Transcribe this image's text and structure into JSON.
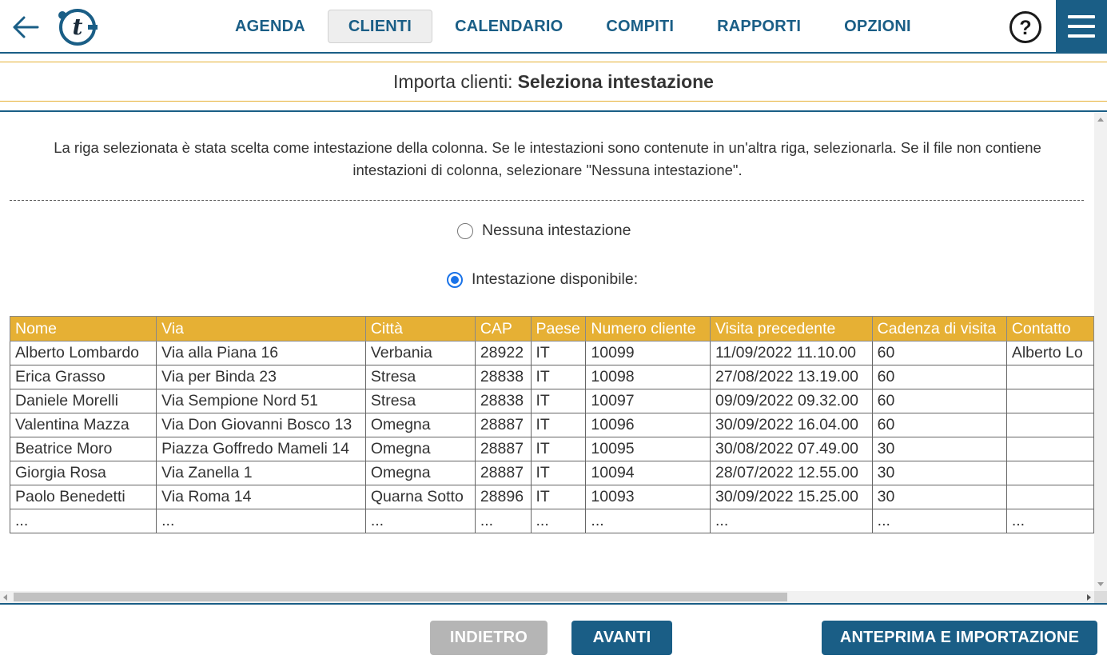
{
  "nav": {
    "items": [
      {
        "label": "AGENDA",
        "active": false
      },
      {
        "label": "CLIENTI",
        "active": true
      },
      {
        "label": "CALENDARIO",
        "active": false
      },
      {
        "label": "COMPITI",
        "active": false
      },
      {
        "label": "RAPPORTI",
        "active": false
      },
      {
        "label": "OPZIONI",
        "active": false
      }
    ],
    "help_label": "?",
    "logo_letter": "t"
  },
  "page": {
    "title_prefix": "Importa clienti:",
    "title_main": "Seleziona intestazione",
    "intro": "La riga selezionata è stata scelta come intestazione della colonna. Se le intestazioni sono contenute in un'altra riga, selezionarla. Se il file non contiene intestazioni di colonna, selezionare \"Nessuna intestazione\"."
  },
  "options": {
    "no_header": {
      "label": "Nessuna intestazione",
      "checked": false
    },
    "header_available": {
      "label": "Intestazione disponibile:",
      "checked": true
    }
  },
  "table": {
    "columns": [
      "Nome",
      "Via",
      "Città",
      "CAP",
      "Paese",
      "Numero cliente",
      "Visita precedente",
      "Cadenza di visita",
      "Contatto"
    ],
    "rows": [
      [
        "Alberto Lombardo",
        "Via alla Piana 16",
        "Verbania",
        "28922",
        "IT",
        "10099",
        "11/09/2022 11.10.00",
        "60",
        "Alberto Lo"
      ],
      [
        "Erica Grasso",
        "Via per Binda 23",
        "Stresa",
        "28838",
        "IT",
        "10098",
        "27/08/2022 13.19.00",
        "60",
        ""
      ],
      [
        "Daniele Morelli",
        "Via Sempione Nord 51",
        "Stresa",
        "28838",
        "IT",
        "10097",
        "09/09/2022 09.32.00",
        "60",
        ""
      ],
      [
        "Valentina Mazza",
        "Via Don Giovanni Bosco 13",
        "Omegna",
        "28887",
        "IT",
        "10096",
        "30/09/2022 16.04.00",
        "60",
        ""
      ],
      [
        "Beatrice Moro",
        "Piazza Goffredo Mameli 14",
        "Omegna",
        "28887",
        "IT",
        "10095",
        "30/08/2022 07.49.00",
        "30",
        ""
      ],
      [
        "Giorgia Rosa",
        "Via Zanella 1",
        "Omegna",
        "28887",
        "IT",
        "10094",
        "28/07/2022 12.55.00",
        "30",
        ""
      ],
      [
        "Paolo Benedetti",
        "Via Roma 14",
        "Quarna Sotto",
        "28896",
        "IT",
        "10093",
        "30/09/2022 15.25.00",
        "30",
        ""
      ],
      [
        "...",
        "...",
        "...",
        "...",
        "...",
        "...",
        "...",
        "...",
        "..."
      ]
    ]
  },
  "footer": {
    "back_label": "INDIETRO",
    "next_label": "AVANTI",
    "import_label": "ANTEPRIMA E IMPORTAZIONE"
  },
  "colors": {
    "primary": "#1a5e86",
    "header_accent": "#e6b034",
    "disabled": "#b5b5b5",
    "radio_selected": "#1a73e8"
  }
}
